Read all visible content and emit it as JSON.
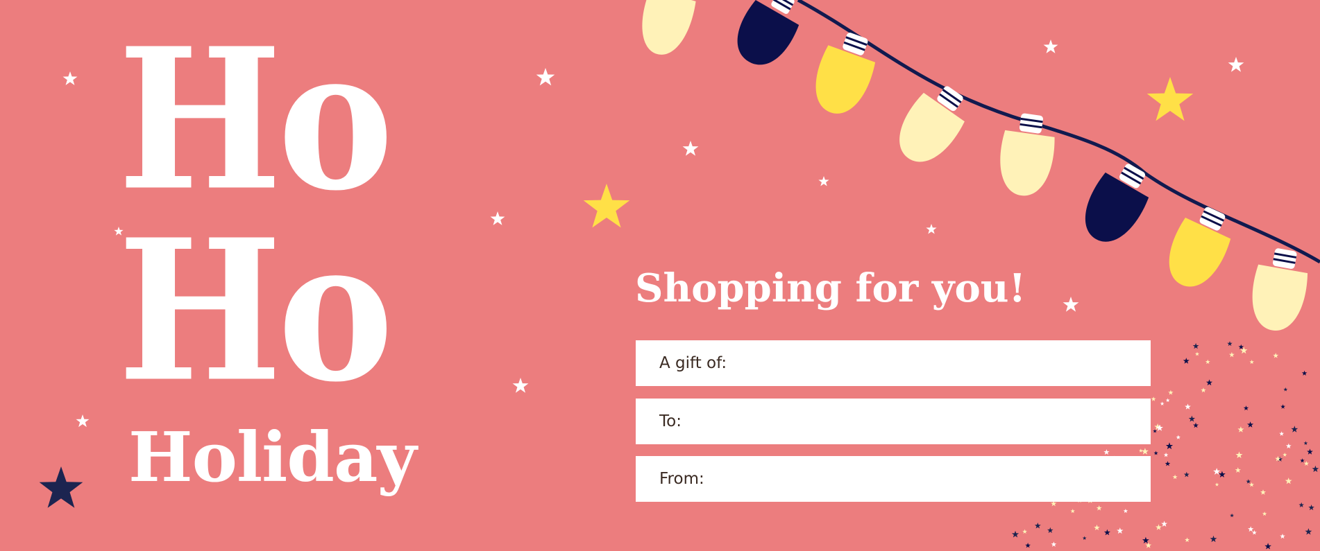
{
  "card": {
    "headline_line1": "Ho",
    "headline_line2": "Ho",
    "subtitle": "Holiday",
    "tagline": "Shopping for you!"
  },
  "fields": [
    {
      "label": "A gift of:"
    },
    {
      "label": "To:"
    },
    {
      "label": "From:"
    }
  ],
  "colors": {
    "background": "#ec7d7e",
    "text": "#ffffff",
    "navy": "#0b0f4a",
    "yellow": "#ffe047",
    "cream": "#fff2b8",
    "field_text": "#3a2a22"
  },
  "decor": {
    "icons": [
      "star-icon",
      "light-bulb-icon",
      "light-string-icon",
      "confetti-icon"
    ]
  }
}
